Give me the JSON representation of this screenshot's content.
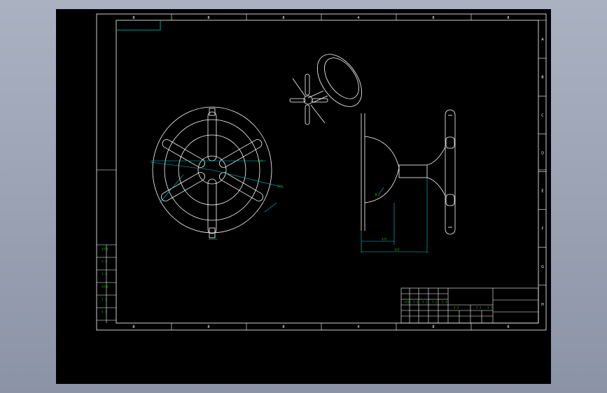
{
  "colors": {
    "background_outer": "#9aa2b4",
    "sheet": "#000000",
    "line": "#ffffff",
    "dimension": "#00c8c8",
    "text": "#00ff00"
  },
  "border": {
    "top_zones": [
      "8",
      "8",
      "8",
      "4",
      "8",
      "8"
    ],
    "bottom_zones": [
      "8",
      "8",
      "8",
      "4",
      "8",
      "8"
    ],
    "side_zones": [
      "A",
      "B",
      "C",
      "D",
      "E",
      "F",
      "G",
      "H"
    ]
  },
  "left_strip_labels": [
    "????",
    "? ?",
    "? ?",
    "????",
    "? ?",
    "? ?"
  ],
  "dimension_labels": {
    "front_view_angle": "???",
    "front_view_diameter": "???",
    "side_view_radius": "R",
    "side_view_height": "???",
    "side_view_width": "???"
  },
  "title_block": {
    "cells": [
      "????",
      "? ?",
      "? ?",
      "? ?",
      "? ?",
      "? ?",
      "? ?",
      "? ?"
    ]
  }
}
